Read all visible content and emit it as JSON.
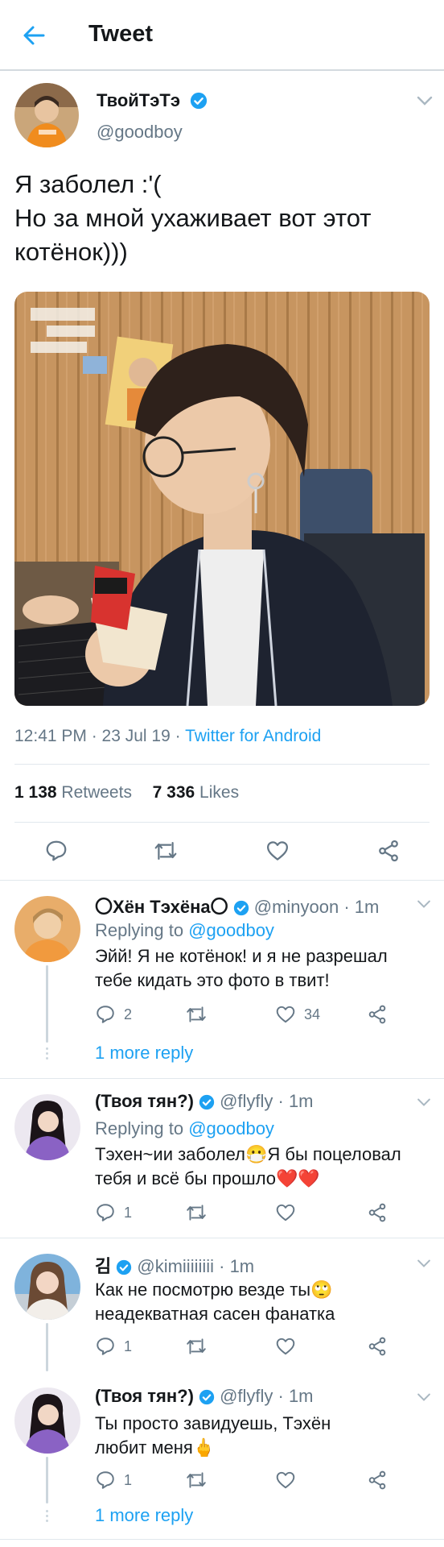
{
  "header": {
    "title": "Tweet"
  },
  "tweet": {
    "name": "ТвойТэТэ",
    "handle": "@goodboy",
    "text_lines": [
      "Я заболел :'(",
      "Но за мной ухаживает вот этот",
      "котёнок)))"
    ],
    "time": "12:41 PM · 23 Jul 19 · ",
    "source": "Twitter for Android",
    "retweets_count": "1 138",
    "retweets_label": "Retweets",
    "likes_count": "7 336",
    "likes_label": "Likes"
  },
  "replies": [
    {
      "name": "〇Хён Тэхёна〇",
      "meta": "@minyoon · 1m",
      "replying_label": "Replying to ",
      "replying_handle": "@goodboy",
      "text_lines": [
        "Эйй! Я не котёнок! и я не разрешал",
        "тебе кидать это фото в твит!"
      ],
      "reply_count": "2",
      "like_count": "34",
      "more": "1 more reply"
    },
    {
      "name": "(Твоя тян?)",
      "meta": "@flyfly · 1m",
      "replying_label": "Replying to ",
      "replying_handle": "@goodboy",
      "text_lines": [
        "Тэхен~ии заболел😷Я бы поцеловал",
        "тебя и всё бы прошло❤️❤️"
      ],
      "reply_count": "1"
    },
    {
      "name": "김",
      "meta": "@kimiiiiiiii · 1m",
      "text_lines": [
        "Как не посмотрю везде ты🙄",
        "неадекватная сасен фанатка"
      ],
      "reply_count": "1"
    },
    {
      "name": "(Твоя тян?)",
      "meta": "@flyfly · 1m",
      "text_lines": [
        "Ты просто завидуешь, Тэхён",
        "любит меня🖕"
      ],
      "reply_count": "1",
      "more": "1 more reply"
    }
  ],
  "icons": [
    "back-arrow-icon",
    "verified-icon",
    "chevron-down-icon",
    "reply-icon",
    "retweet-icon",
    "like-icon",
    "share-icon"
  ],
  "colors": {
    "accent": "#1da1f2",
    "secondary_text": "#657786",
    "divider": "#e1e8ed"
  }
}
